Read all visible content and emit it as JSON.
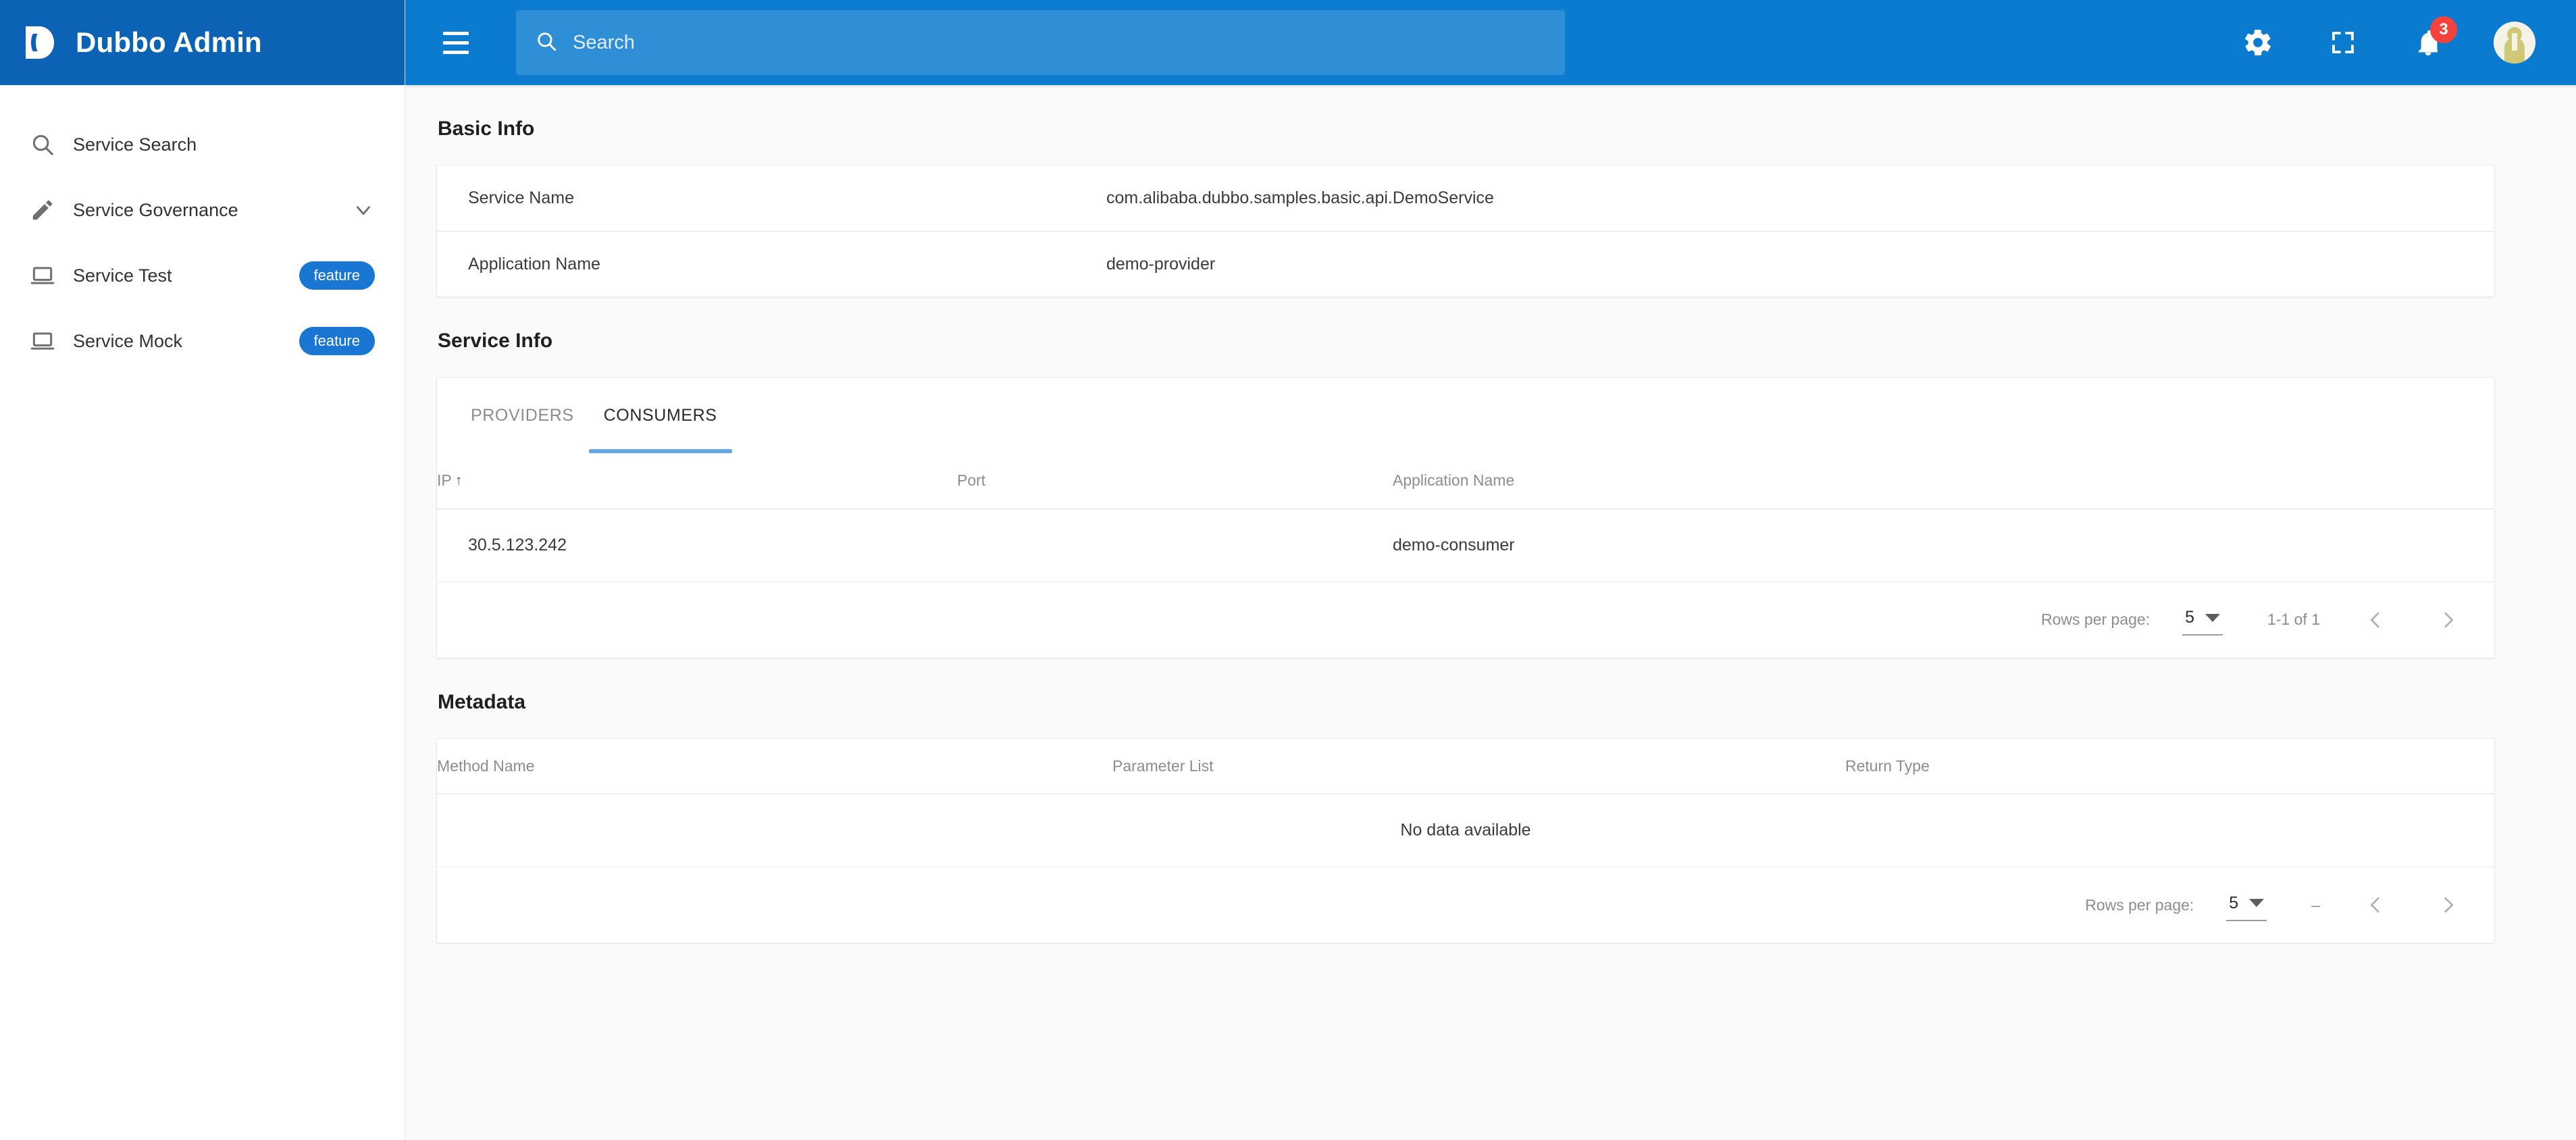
{
  "brand": {
    "title": "Dubbo Admin",
    "logo_icon": "dubbo-logo-icon"
  },
  "sidebar": {
    "items": [
      {
        "label": "Service Search",
        "icon": "search-icon",
        "badge": null,
        "chevron": false
      },
      {
        "label": "Service Governance",
        "icon": "pencil-icon",
        "badge": null,
        "chevron": true
      },
      {
        "label": "Service Test",
        "icon": "laptop-icon",
        "badge": "feature",
        "chevron": false
      },
      {
        "label": "Service Mock",
        "icon": "laptop-icon",
        "badge": "feature",
        "chevron": false
      }
    ]
  },
  "topbar": {
    "menu_icon": "hamburger-icon",
    "search": {
      "icon": "search-icon",
      "value": "",
      "placeholder": "Search"
    },
    "settings_icon": "gear-icon",
    "fullscreen_icon": "fullscreen-icon",
    "notifications_icon": "bell-icon",
    "notifications_count": "3",
    "avatar_icon": "user-avatar"
  },
  "main": {
    "basic_info": {
      "title": "Basic Info",
      "rows": [
        {
          "key": "Service Name",
          "value": "com.alibaba.dubbo.samples.basic.api.DemoService"
        },
        {
          "key": "Application Name",
          "value": "demo-provider"
        }
      ]
    },
    "service_info": {
      "title": "Service Info",
      "tabs": [
        {
          "label": "PROVIDERS",
          "active": false
        },
        {
          "label": "CONSUMERS",
          "active": true
        }
      ],
      "columns": [
        "IP",
        "Port",
        "Application Name"
      ],
      "sort_column": "IP",
      "sort_direction": "asc",
      "sort_arrow": "↑",
      "rows": [
        {
          "ip": "30.5.123.242",
          "port": "",
          "application_name": "demo-consumer"
        }
      ],
      "pager": {
        "rows_per_page_label": "Rows per page:",
        "rows_per_page_value": "5",
        "range": "1-1 of 1",
        "prev_icon": "chevron-left-icon",
        "next_icon": "chevron-right-icon"
      }
    },
    "metadata": {
      "title": "Metadata",
      "columns": [
        "Method Name",
        "Parameter List",
        "Return Type"
      ],
      "rows": [],
      "empty_text": "No data available",
      "pager": {
        "rows_per_page_label": "Rows per page:",
        "rows_per_page_value": "5",
        "range": "–",
        "prev_icon": "chevron-left-icon",
        "next_icon": "chevron-right-icon"
      }
    }
  },
  "colors": {
    "brand_dark": "#0c63b5",
    "topbar_blue": "#0a7bcf",
    "search_field": "#2e8ed6",
    "badge_blue": "#1976d2",
    "notification_red": "#f4433c",
    "tab_underline": "#64a4e8",
    "page_bg": "#fafafa",
    "card_bg": "#ffffff"
  }
}
